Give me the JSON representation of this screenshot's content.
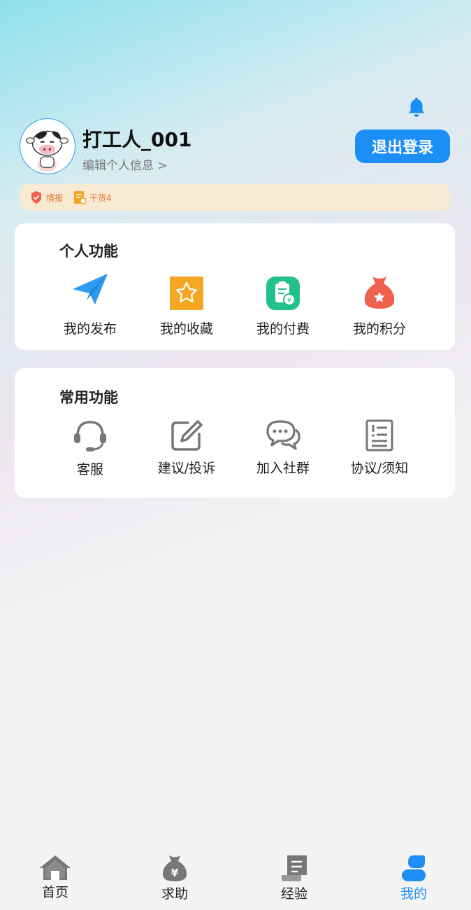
{
  "header": {
    "username": "打工人_001",
    "edit_profile": "编辑个人信息 >",
    "logout": "退出登录",
    "badges": [
      {
        "icon": "shield-check-icon",
        "label": "情报",
        "color": "#f0614d"
      },
      {
        "icon": "document-icon",
        "label": "干货4",
        "color": "#f5a623"
      }
    ]
  },
  "personal": {
    "title": "个人功能",
    "items": [
      {
        "label": "我的发布",
        "icon": "paper-plane-icon",
        "color": "#2d9bf0"
      },
      {
        "label": "我的收藏",
        "icon": "star-icon",
        "color": "#f5a623"
      },
      {
        "label": "我的付费",
        "icon": "payment-doc-icon",
        "color": "#22c08b"
      },
      {
        "label": "我的积分",
        "icon": "money-bag-icon",
        "color": "#f0614d"
      }
    ]
  },
  "common": {
    "title": "常用功能",
    "items": [
      {
        "label": "客服",
        "icon": "headset-icon"
      },
      {
        "label": "建议/投诉",
        "icon": "edit-icon"
      },
      {
        "label": "加入社群",
        "icon": "chat-icon"
      },
      {
        "label": "协议/须知",
        "icon": "notice-doc-icon"
      }
    ]
  },
  "tabbar": {
    "items": [
      {
        "label": "首页",
        "icon": "home-icon"
      },
      {
        "label": "求助",
        "icon": "money-bag-icon"
      },
      {
        "label": "经验",
        "icon": "scroll-icon"
      },
      {
        "label": "我的",
        "icon": "user-icon",
        "active": true
      }
    ],
    "active_color": "#1d8ef5"
  },
  "colors": {
    "accent": "#1d8ef5",
    "badge_bg": "#f8e9d2"
  }
}
